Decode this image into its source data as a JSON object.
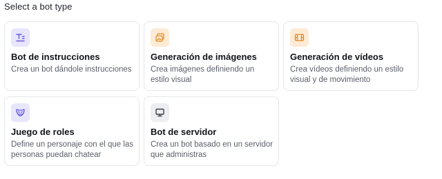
{
  "heading": "Select a bot type",
  "colors": {
    "icon_purple_bg": "#e8e6fb",
    "icon_purple_fg": "#6a5ae0",
    "icon_orange_bg": "#fdebd6",
    "icon_orange_fg": "#e08a1e",
    "icon_gray_bg": "#eceef1",
    "icon_gray_fg": "#3a3f45"
  },
  "cards": [
    {
      "icon": "text-lines-icon",
      "title": "Bot de instrucciones",
      "description": "Crea un bot dándole instrucciones"
    },
    {
      "icon": "images-icon",
      "title": "Generación de imágenes",
      "description": "Crea imágenes definiendo un estilo visual"
    },
    {
      "icon": "film-icon",
      "title": "Generación de vídeos",
      "description": "Crea vídeos definiendo un estilo visual y de movimiento"
    },
    {
      "icon": "mask-icon",
      "title": "Juego de roles",
      "description": "Define un personaje con el que las personas puedan chatear"
    },
    {
      "icon": "monitor-icon",
      "title": "Bot de servidor",
      "description": "Crea un bot basado en un servidor que administras"
    }
  ]
}
